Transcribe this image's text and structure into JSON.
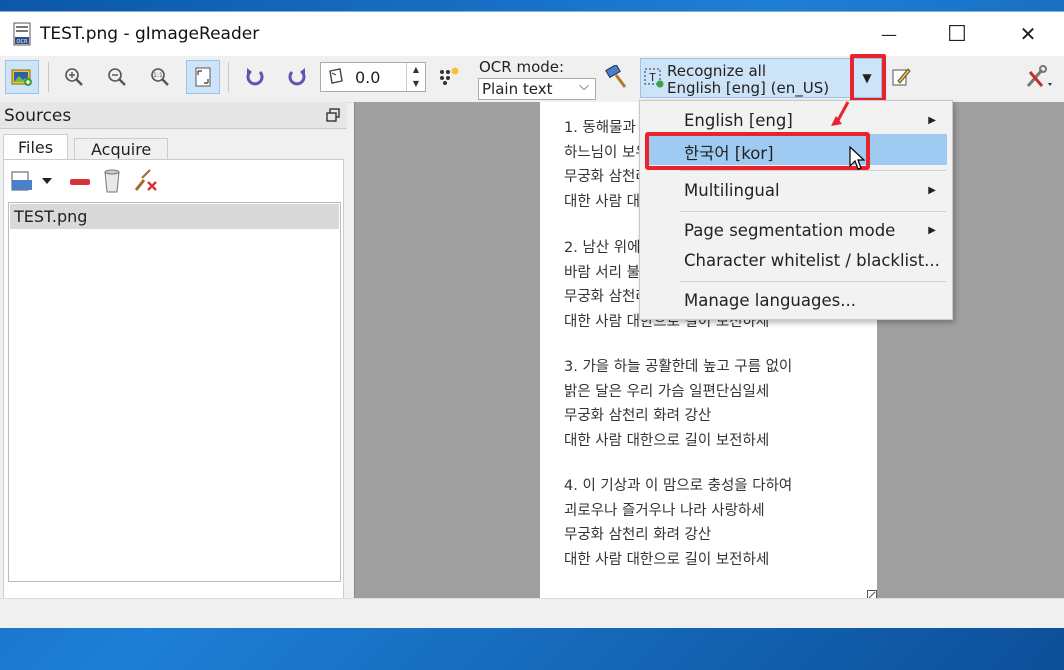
{
  "window": {
    "title": "TEST.png - gImageReader",
    "minimize_glyph": "—",
    "maximize_glyph": "☐",
    "close_glyph": "✕"
  },
  "toolbar": {
    "rotation_value": "0.0",
    "ocr_mode_label": "OCR mode:",
    "ocr_mode_value": "Plain text",
    "recognize_line1": "Recognize all",
    "recognize_line2": "English [eng] (en_US)"
  },
  "sources": {
    "header": "Sources",
    "tabs": [
      {
        "label": "Files"
      },
      {
        "label": "Acquire"
      }
    ],
    "files": [
      {
        "name": "TEST.png"
      }
    ]
  },
  "page_text": [
    "1. 동해물과 백두산이 마르고 닳도록",
    "하느님이 보우하사 우리나라 만세",
    "무궁화 삼천리 화려 강산",
    "대한 사람 대한으로 길이 보전하세",
    "2. 남산 위에 저 소나무 철갑을 두른 듯",
    "바람 서리 불변함은 우리 기상일세",
    "무궁화 삼천리 화려 강산",
    "대한 사람 대한으로 길이 보전하세",
    "3. 가을 하늘 공활한데 높고 구름 없이",
    "밝은 달은 우리 가슴 일편단심일세",
    "무궁화 삼천리 화려 강산",
    "대한 사람 대한으로 길이 보전하세",
    "4. 이 기상과 이 맘으로 충성을 다하여",
    "괴로우나 즐거우나 나라 사랑하세",
    "무궁화 삼천리 화려 강산",
    "대한 사람 대한으로 길이 보전하세"
  ],
  "language_menu": {
    "items": [
      {
        "label": "English [eng]",
        "submenu": true
      },
      {
        "label": "한국어 [kor]",
        "submenu": false,
        "highlighted": true
      },
      {
        "label": "Multilingual",
        "submenu": true
      },
      {
        "label": "Page segmentation mode",
        "submenu": true
      },
      {
        "label": "Character whitelist / blacklist...",
        "submenu": false
      },
      {
        "label": "Manage languages...",
        "submenu": false
      }
    ]
  },
  "colors": {
    "highlight": "#9fcbf3",
    "annotation_red": "#e8232b",
    "active_button": "#cde3f7"
  }
}
